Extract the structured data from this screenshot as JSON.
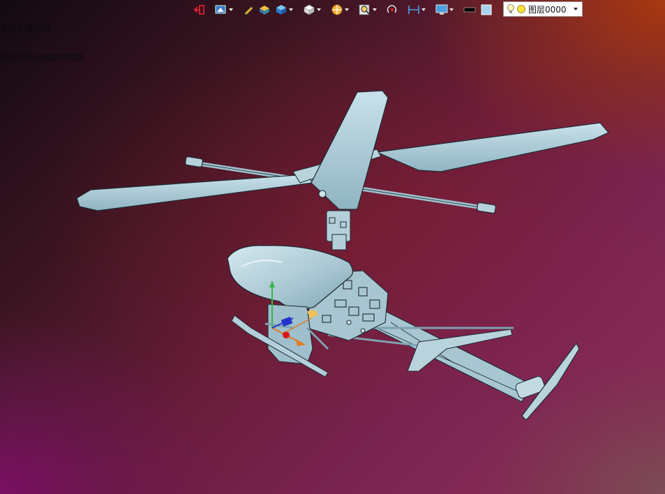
{
  "hint": {
    "line1": "单击左键选择",
    "line2": "按住鼠标中键旋转视图"
  },
  "toolbar": {
    "buttons": [
      {
        "icon": "exit-arrow-icon",
        "dropdown": false
      },
      {
        "icon": "view-orientation-icon",
        "dropdown": true
      },
      {
        "icon": "sketch-pencil-icon",
        "dropdown": false
      },
      {
        "icon": "shaded-box-icon",
        "dropdown": false
      },
      {
        "icon": "blue-cube-icon",
        "dropdown": true
      },
      {
        "icon": "white-cube-icon",
        "dropdown": true
      },
      {
        "icon": "section-wheel-icon",
        "dropdown": true
      },
      {
        "icon": "zoom-fit-icon",
        "dropdown": true
      },
      {
        "icon": "rotate-point-icon",
        "dropdown": false
      },
      {
        "icon": "measure-dimension-icon",
        "dropdown": true
      },
      {
        "icon": "display-monitor-icon",
        "dropdown": true
      },
      {
        "icon": "black-color-swatch-icon",
        "dropdown": false
      },
      {
        "icon": "light-blue-swatch-icon",
        "dropdown": false
      },
      {
        "icon": "layer-stack-icon",
        "dropdown": true
      }
    ]
  },
  "layer": {
    "current": "图层0000"
  },
  "colors": {
    "model_fill": "#a9c9d4",
    "model_stroke": "#1e2b33",
    "accent_orange": "#e07a1e"
  }
}
